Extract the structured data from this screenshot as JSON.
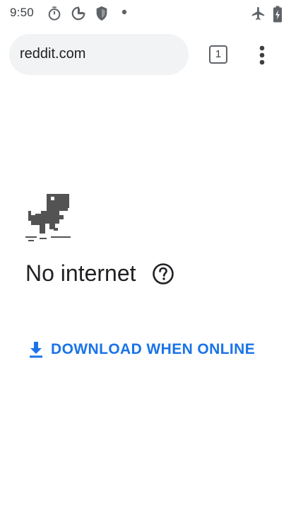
{
  "status_bar": {
    "time": "9:50",
    "icons": [
      "stopwatch-icon",
      "photos-icon",
      "shield-icon",
      "dot-icon",
      "airplane-icon",
      "battery-icon"
    ]
  },
  "toolbar": {
    "url": "reddit.com",
    "tab_count": "1",
    "menu_icon": "more-vert-icon"
  },
  "error_page": {
    "illustration": "dino-icon",
    "title": "No internet",
    "help_icon": "help-circle-icon",
    "download_label": "DOWNLOAD WHEN ONLINE",
    "download_icon": "download-icon"
  },
  "colors": {
    "accent": "#1a73e8",
    "text": "#202124",
    "omnibox_bg": "#f1f3f4",
    "icon": "#5f6368"
  }
}
